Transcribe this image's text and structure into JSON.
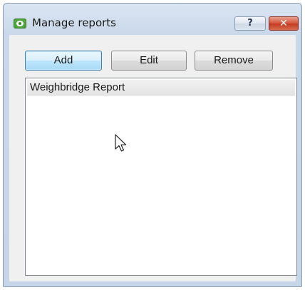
{
  "window": {
    "title": "Manage reports",
    "help_glyph": "?",
    "close_glyph": "✕"
  },
  "toolbar": {
    "add_label": "Add",
    "edit_label": "Edit",
    "remove_label": "Remove"
  },
  "reports": {
    "items": [
      {
        "label": "Weighbridge Report"
      }
    ]
  },
  "icons": {
    "app": "eye-icon",
    "help": "help-icon",
    "close": "close-icon",
    "cursor": "mouse-pointer-icon"
  },
  "colors": {
    "title_bar": "#cfdcec",
    "close_button": "#c33a1f",
    "default_button_border": "#3c7fb1",
    "app_icon": "#4fa63a"
  }
}
